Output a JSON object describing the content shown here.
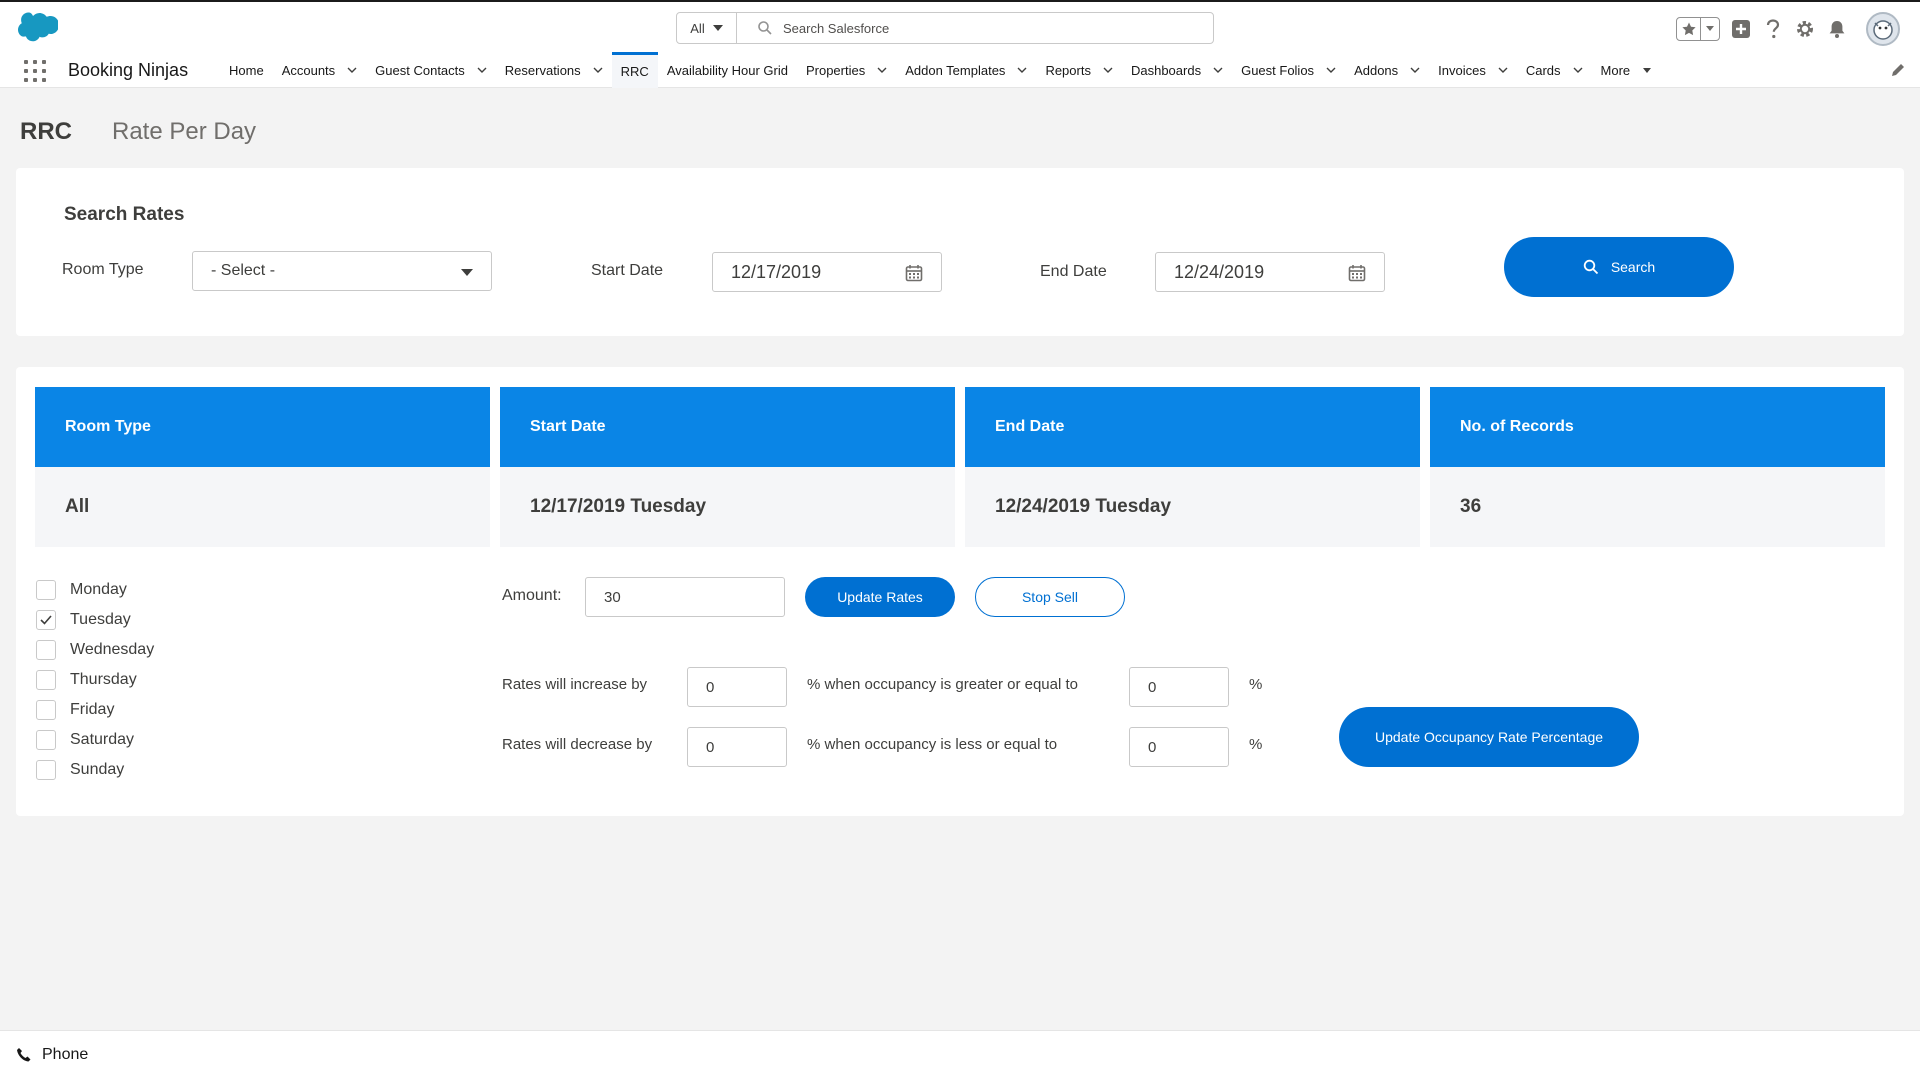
{
  "header": {
    "search_scope": "All",
    "search_placeholder": "Search Salesforce"
  },
  "nav": {
    "app_name": "Booking Ninjas",
    "items": [
      {
        "label": "Home",
        "dropdown": false
      },
      {
        "label": "Accounts",
        "dropdown": true
      },
      {
        "label": "Guest Contacts",
        "dropdown": true
      },
      {
        "label": "Reservations",
        "dropdown": true
      },
      {
        "label": "RRC",
        "dropdown": false,
        "active": true
      },
      {
        "label": "Availability Hour Grid",
        "dropdown": false
      },
      {
        "label": "Properties",
        "dropdown": true
      },
      {
        "label": "Addon Templates",
        "dropdown": true
      },
      {
        "label": "Reports",
        "dropdown": true
      },
      {
        "label": "Dashboards",
        "dropdown": true
      },
      {
        "label": "Guest Folios",
        "dropdown": true
      },
      {
        "label": "Addons",
        "dropdown": true
      },
      {
        "label": "Invoices",
        "dropdown": true
      },
      {
        "label": "Cards",
        "dropdown": true
      },
      {
        "label": "More",
        "dropdown": true
      }
    ]
  },
  "page": {
    "title": "RRC",
    "subtitle": "Rate Per Day"
  },
  "search_card": {
    "title": "Search Rates",
    "room_type_label": "Room Type",
    "room_type_value": "- Select -",
    "start_date_label": "Start Date",
    "start_date_value": "12/17/2019",
    "end_date_label": "End Date",
    "end_date_value": "12/24/2019",
    "search_button": "Search"
  },
  "summary": {
    "columns": [
      {
        "header": "Room Type",
        "value": "All"
      },
      {
        "header": "Start Date",
        "value": "12/17/2019 Tuesday"
      },
      {
        "header": "End Date",
        "value": "12/24/2019 Tuesday"
      },
      {
        "header": "No. of Records",
        "value": "36"
      }
    ]
  },
  "days": [
    {
      "label": "Monday",
      "checked": false
    },
    {
      "label": "Tuesday",
      "checked": true
    },
    {
      "label": "Wednesday",
      "checked": false
    },
    {
      "label": "Thursday",
      "checked": false
    },
    {
      "label": "Friday",
      "checked": false
    },
    {
      "label": "Saturday",
      "checked": false
    },
    {
      "label": "Sunday",
      "checked": false
    }
  ],
  "rates": {
    "amount_label": "Amount:",
    "amount_value": "30",
    "update_rates_button": "Update Rates",
    "stop_sell_button": "Stop Sell",
    "increase_label": "Rates will increase by",
    "increase_value": "0",
    "increase_condition": "% when occupancy is greater or equal to",
    "increase_occupancy": "0",
    "decrease_label": "Rates will decrease by",
    "decrease_value": "0",
    "decrease_condition": "% when occupancy is less or equal to",
    "decrease_occupancy": "0",
    "percent_symbol": "%",
    "update_occupancy_button": "Update Occupancy Rate Percentage"
  },
  "footer": {
    "phone_label": "Phone"
  },
  "colors": {
    "brand_blue": "#0070d2",
    "header_blue": "#0a85e6",
    "cloud_blue": "#1798c1"
  }
}
